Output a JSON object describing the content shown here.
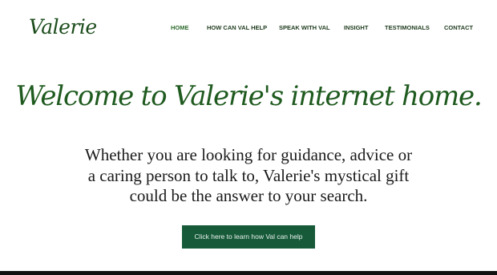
{
  "header": {
    "logo_text": "Valerie",
    "nav": [
      {
        "label": "HOME",
        "active": true
      },
      {
        "label": "HOW CAN VAL HELP",
        "active": false
      },
      {
        "label": "SPEAK WITH VAL",
        "active": false
      },
      {
        "label": "INSIGHT",
        "active": false
      },
      {
        "label": "TESTIMONIALS",
        "active": false
      },
      {
        "label": "CONTACT",
        "active": false
      }
    ]
  },
  "hero": {
    "title": "Welcome to Valerie's internet home.",
    "text_lines": [
      "Whether you are looking for guidance, advice or",
      "a caring person to talk to, Valerie's mystical gift",
      "could be the answer to your search."
    ],
    "cta_label": "Click here to learn how Val can help"
  },
  "colors": {
    "brand_green": "#1f5a1f",
    "cta_background": "#175a3a",
    "nav_active": "#2e6b2e"
  }
}
